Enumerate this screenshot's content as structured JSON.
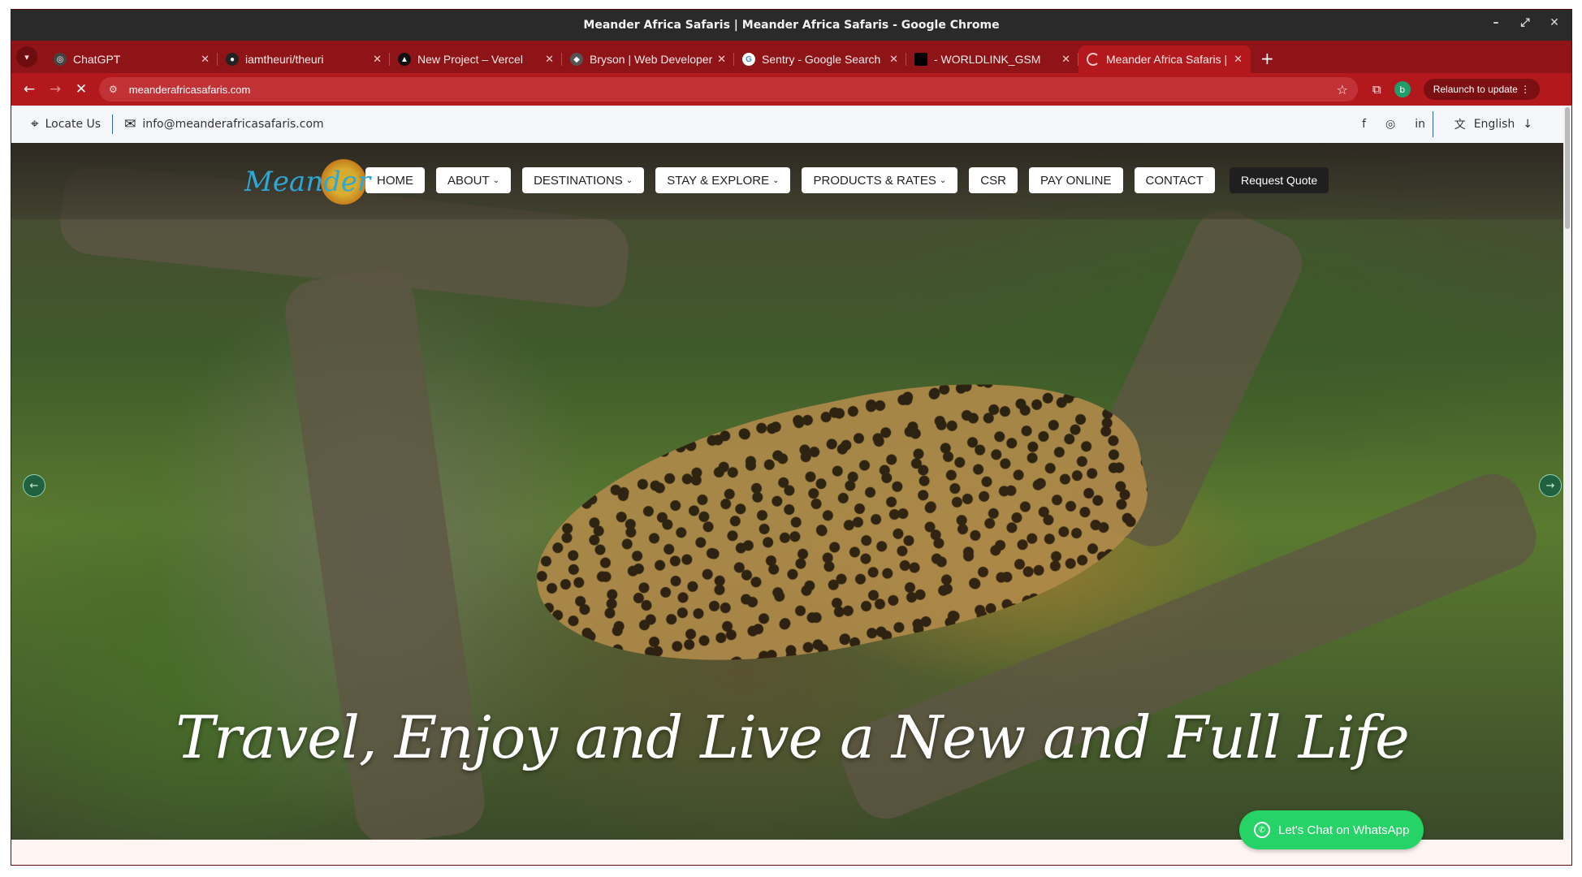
{
  "window": {
    "title": "Meander Africa Safaris | Meander Africa Safaris - Google Chrome",
    "controls": {
      "minimize": "–",
      "maximize": "⤢",
      "close": "✕"
    }
  },
  "tabs": [
    {
      "label": "ChatGPT",
      "icon": "chatgpt-icon"
    },
    {
      "label": "iamtheuri/theuri",
      "icon": "github-icon"
    },
    {
      "label": "New Project – Vercel",
      "icon": "vercel-icon"
    },
    {
      "label": "Bryson | Web Developer",
      "icon": "site-icon"
    },
    {
      "label": "Sentry - Google Search",
      "icon": "google-icon"
    },
    {
      "label": "- WORLDLINK_GSM",
      "icon": "site-icon"
    },
    {
      "label": "Meander Africa Safaris | M",
      "icon": "loading-icon",
      "active": true
    }
  ],
  "toolbar": {
    "url": "meanderafricasafaris.com",
    "relaunch_label": "Relaunch to update",
    "avatar_letter": "b"
  },
  "site_top": {
    "locate_label": "Locate Us",
    "email": "info@meanderafricasafaris.com",
    "language": "English",
    "socials": [
      "facebook-icon",
      "instagram-icon",
      "linkedin-icon"
    ]
  },
  "nav": {
    "logo_text": "Meander",
    "items": [
      {
        "label": "HOME"
      },
      {
        "label": "ABOUT",
        "caret": "⌄"
      },
      {
        "label": "DESTINATIONS",
        "caret": "⌄"
      },
      {
        "label": "STAY & EXPLORE",
        "caret": "⌄"
      },
      {
        "label": "PRODUCTS & RATES",
        "caret": "⌄"
      },
      {
        "label": "CSR"
      },
      {
        "label": "PAY ONLINE"
      },
      {
        "label": "CONTACT"
      }
    ],
    "quote_label": "Request Quote"
  },
  "hero": {
    "headline": "Travel, Enjoy and Live a New and Full Life"
  },
  "whatsapp": {
    "label": "Let's Chat on WhatsApp"
  },
  "colors": {
    "browser_frame": "#b3181d",
    "tabstrip": "#8e1418",
    "whatsapp": "#25d366"
  }
}
